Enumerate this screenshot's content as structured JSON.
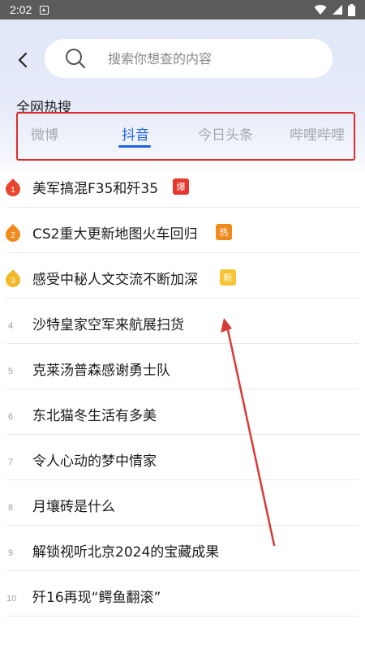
{
  "status_bar": {
    "time": "2:02"
  },
  "search": {
    "placeholder": "搜索你想查的内容"
  },
  "section": {
    "title": "全网热搜"
  },
  "tabs": [
    {
      "label": "微博",
      "active": false
    },
    {
      "label": "抖音",
      "active": true
    },
    {
      "label": "今日头条",
      "active": false
    },
    {
      "label": "哔哩哔哩",
      "active": false
    }
  ],
  "hot_list": [
    {
      "rank": "1",
      "title": "美军搞混F35和歼35",
      "tag": "爆",
      "tag_color": "#e6372e",
      "badge_color": "#e8442e"
    },
    {
      "rank": "2",
      "title": "CS2重大更新地图火车回归",
      "tag": "热",
      "tag_color": "#f08a1c",
      "badge_color": "#f08a1c"
    },
    {
      "rank": "3",
      "title": "感受中秘人文交流不断加深",
      "tag": "新",
      "tag_color": "#f7c436",
      "badge_color": "#f2b82a"
    },
    {
      "rank": "4",
      "title": "沙特皇家空军来航展扫货"
    },
    {
      "rank": "5",
      "title": "克莱汤普森感谢勇士队"
    },
    {
      "rank": "6",
      "title": "东北猫冬生活有多美"
    },
    {
      "rank": "7",
      "title": "令人心动的梦中情家"
    },
    {
      "rank": "8",
      "title": "月壤砖是什么"
    },
    {
      "rank": "9",
      "title": "解锁视听北京2024的宝藏成果"
    },
    {
      "rank": "10",
      "title": "歼16再现“鳄鱼翻滚”"
    }
  ],
  "colors": {
    "accent": "#1f63e6",
    "highlight_border": "#e02b2b",
    "annotation_arrow": "#d83a36"
  }
}
